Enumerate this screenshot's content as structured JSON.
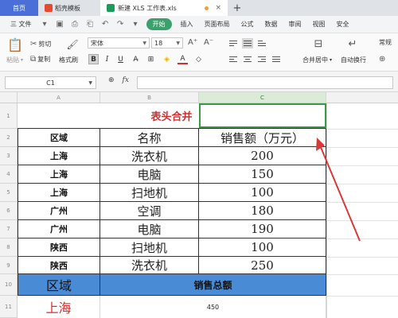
{
  "tabs": [
    {
      "label": "首页"
    },
    {
      "label": "稻壳模板"
    },
    {
      "label": "新建 XLS 工作表.xls"
    }
  ],
  "menubar": {
    "file_label": "三 文件",
    "start_label": "开始",
    "items": [
      "插入",
      "页面布局",
      "公式",
      "数据",
      "审阅",
      "视图",
      "安全"
    ]
  },
  "ribbon": {
    "paste_label": "粘贴",
    "cut_label": "剪切",
    "copy_label": "复制",
    "format_painter_label": "格式刷",
    "font_name": "宋体",
    "font_size": "18",
    "bold_label": "B",
    "italic_label": "I",
    "underline_label": "U",
    "merge_label": "合并居中",
    "wrap_label": "自动换行",
    "number_format": "常规",
    "font_color": "#d32f2f"
  },
  "formula_bar": {
    "cell_ref": "C1",
    "fx_label": "fx",
    "value": ""
  },
  "columns": [
    "A",
    "B",
    "C"
  ],
  "rows": [
    "1",
    "2",
    "3",
    "4",
    "5",
    "6",
    "7",
    "8",
    "9",
    "10",
    "11"
  ],
  "sheet": {
    "title": "表头合并",
    "headers": [
      "区域",
      "名称",
      "销售额（万元）"
    ],
    "data": [
      [
        "上海",
        "洗衣机",
        "200"
      ],
      [
        "上海",
        "电脑",
        "150"
      ],
      [
        "上海",
        "扫地机",
        "100"
      ],
      [
        "广州",
        "空调",
        "180"
      ],
      [
        "广州",
        "电脑",
        "190"
      ],
      [
        "陕西",
        "扫地机",
        "100"
      ],
      [
        "陕西",
        "洗衣机",
        "250"
      ]
    ],
    "summary_header": [
      "区域",
      "销售总额"
    ],
    "summary_row": [
      "上海",
      "450"
    ]
  },
  "colors": {
    "accent_green": "#3b9a47",
    "title_red": "#d32f2f",
    "summary_blue": "#4a8bd6",
    "arrow_red": "#d83a3a"
  }
}
